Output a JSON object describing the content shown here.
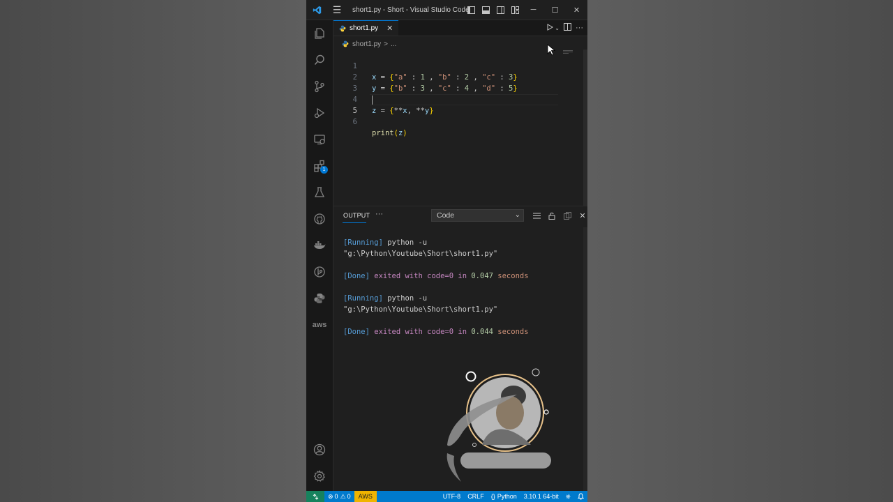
{
  "window": {
    "title": "short1.py - Short - Visual Studio Code"
  },
  "titlebar": {
    "menu_icon": "hamburger-menu-icon",
    "layout_icons": [
      "toggle-primary-sidebar-icon",
      "toggle-panel-icon",
      "toggle-secondary-sidebar-icon",
      "customize-layout-icon"
    ],
    "minimize": "─",
    "maximize": "☐",
    "close": "✕"
  },
  "activity_bar": {
    "items": [
      "explorer-icon",
      "search-icon",
      "source-control-icon",
      "run-debug-icon",
      "remote-explorer-icon",
      "extensions-icon",
      "testing-icon",
      "github-icon",
      "docker-icon",
      "gitlens-icon",
      "python-icon",
      "aws-icon"
    ],
    "extensions_badge": "1",
    "aws_label": "aws",
    "bottom": [
      "accounts-icon",
      "manage-gear-icon"
    ]
  },
  "editor_tab": {
    "label": "short1.py",
    "close": "✕"
  },
  "breadcrumb": {
    "file": "short1.py",
    "separator": ">",
    "more": "..."
  },
  "code": {
    "line_numbers": [
      "1",
      "2",
      "3",
      "4",
      "5",
      "6"
    ],
    "l1": {
      "var": "x",
      "eq": " = ",
      "open": "{",
      "k1": "\"a\"",
      "c1": " : ",
      "v1": "1",
      "sep1": " , ",
      "k2": "\"b\"",
      "c2": " : ",
      "v2": "2",
      "sep2": " , ",
      "k3": "\"c\"",
      "c3": " : ",
      "v3": "3",
      "close": "}"
    },
    "l2": {
      "var": "y",
      "eq": " = ",
      "open": "{",
      "k1": "\"b\"",
      "c1": " : ",
      "v1": "3",
      "sep1": " , ",
      "k2": "\"c\"",
      "c2": " : ",
      "v2": "4",
      "sep2": " , ",
      "k3": "\"d\"",
      "c3": " : ",
      "v3": "5",
      "close": "}"
    },
    "l4": {
      "var": "z",
      "eq": " = ",
      "open": "{",
      "s1": "**",
      "a": "x",
      "comma": ", ",
      "s2": "**",
      "b": "y",
      "close": "}"
    },
    "l6": {
      "fn": "print",
      "open": "(",
      "arg": "z",
      "close": ")"
    }
  },
  "panel": {
    "tab": "OUTPUT",
    "more": "···",
    "channel": "Code",
    "actions": [
      "filter-icon",
      "lock-scroll-icon",
      "clear-output-icon",
      "close-panel-icon"
    ],
    "runs": [
      {
        "running": "[Running]",
        "cmd": " python -u",
        "path": "\"g:\\Python\\Youtube\\Short\\short1.py\"",
        "done": "[Done]",
        "exited": " exited with ",
        "code": "code=0",
        "in": " in ",
        "time": "0.047",
        "seconds": " seconds"
      },
      {
        "running": "[Running]",
        "cmd": " python -u",
        "path": "\"g:\\Python\\Youtube\\Short\\short1.py\"",
        "done": "[Done]",
        "exited": " exited with ",
        "code": "code=0",
        "in": " in ",
        "time": "0.044",
        "seconds": " seconds"
      }
    ]
  },
  "statusbar": {
    "errors": "0",
    "warnings": "0",
    "aws": "AWS",
    "encoding": "UTF-8",
    "eol": "CRLF",
    "language": "Python",
    "interpreter": "3.10.1 64-bit"
  },
  "colors": {
    "accent": "#007acc",
    "remote": "#16825d",
    "aws": "#f0b400"
  }
}
